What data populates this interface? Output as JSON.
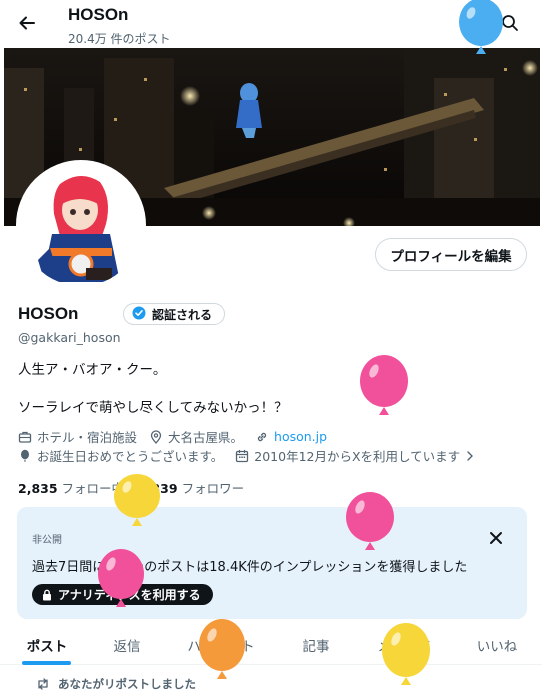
{
  "header": {
    "title": "HOSOn",
    "post_count": "20.4万 件のポスト"
  },
  "profile": {
    "edit_button": "プロフィールを編集",
    "name": "HOSOn",
    "verify_label": "認証される",
    "handle": "@gakkari_hoson",
    "bio_line1": "人生ア・バオア・クー。",
    "bio_line2": "ソーラレイで萌やし尽くしてみないかっ！？",
    "category": "ホテル・宿泊施設",
    "location": "大名古屋県。",
    "website": "hoson.jp",
    "birthday": "お誕生日おめでとうございます。",
    "joined": "2010年12月からXを利用しています",
    "following_count": "2,835",
    "following_label": "フォロー中",
    "followers_count": "4,339",
    "followers_label": "フォロワー"
  },
  "analytics": {
    "private_label": "非公開",
    "message": "過去7日間にあなたのポストは18.4K件のインプレッションを獲得しました",
    "button_label": "アナリティクスを利用する"
  },
  "tabs": [
    {
      "label": "ポスト"
    },
    {
      "label": "返信"
    },
    {
      "label": "ハイライト"
    },
    {
      "label": "記事"
    },
    {
      "label": "メディア"
    },
    {
      "label": "いいね"
    }
  ],
  "repost_notice": "あなたがリポストしました",
  "colors": {
    "accent": "#1d9bf0",
    "balloon_pink": "#f0519a",
    "balloon_yellow": "#f7d63a",
    "balloon_orange": "#f59a3a",
    "balloon_blue": "#4aaef0"
  }
}
